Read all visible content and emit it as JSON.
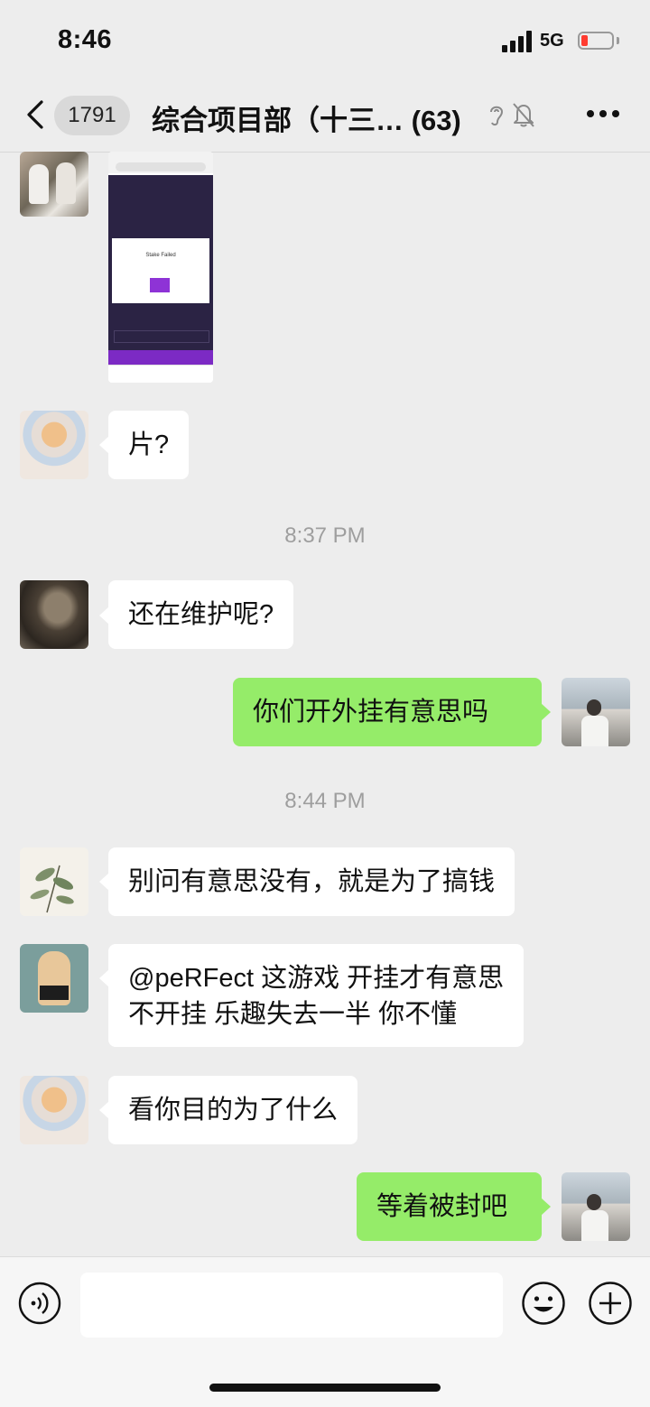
{
  "status_bar": {
    "time": "8:46",
    "network": "5G"
  },
  "nav": {
    "unread_count": "1791",
    "title": "综合项目部（十三…",
    "member_count": "(63)"
  },
  "messages": [
    {
      "type": "image",
      "direction": "in",
      "thumb_text": "Stake Failed"
    },
    {
      "type": "text",
      "direction": "in",
      "text": "片?"
    },
    {
      "type": "timestamp",
      "text": "8:37 PM"
    },
    {
      "type": "text",
      "direction": "in",
      "text": "还在维护呢?"
    },
    {
      "type": "text",
      "direction": "out",
      "text": "你们开外挂有意思吗"
    },
    {
      "type": "timestamp",
      "text": "8:44 PM"
    },
    {
      "type": "text",
      "direction": "in",
      "text": "别问有意思没有，就是为了搞钱"
    },
    {
      "type": "text",
      "direction": "in",
      "line1": "@peRFect 这游戏  开挂才有意思",
      "line2": "不开挂 乐趣失去一半 你不懂"
    },
    {
      "type": "text",
      "direction": "in",
      "text": "看你目的为了什么"
    },
    {
      "type": "text",
      "direction": "out",
      "text": "等着被封吧"
    }
  ],
  "bottom_bar": {
    "input_value": ""
  },
  "colors": {
    "outgoing_bubble": "#95ec69",
    "incoming_bubble": "#ffffff",
    "background": "#ededed"
  },
  "icons": [
    "back-chevron-icon",
    "ear-icon",
    "mute-bell-icon",
    "more-icon",
    "voice-icon",
    "emoji-icon",
    "plus-icon"
  ]
}
